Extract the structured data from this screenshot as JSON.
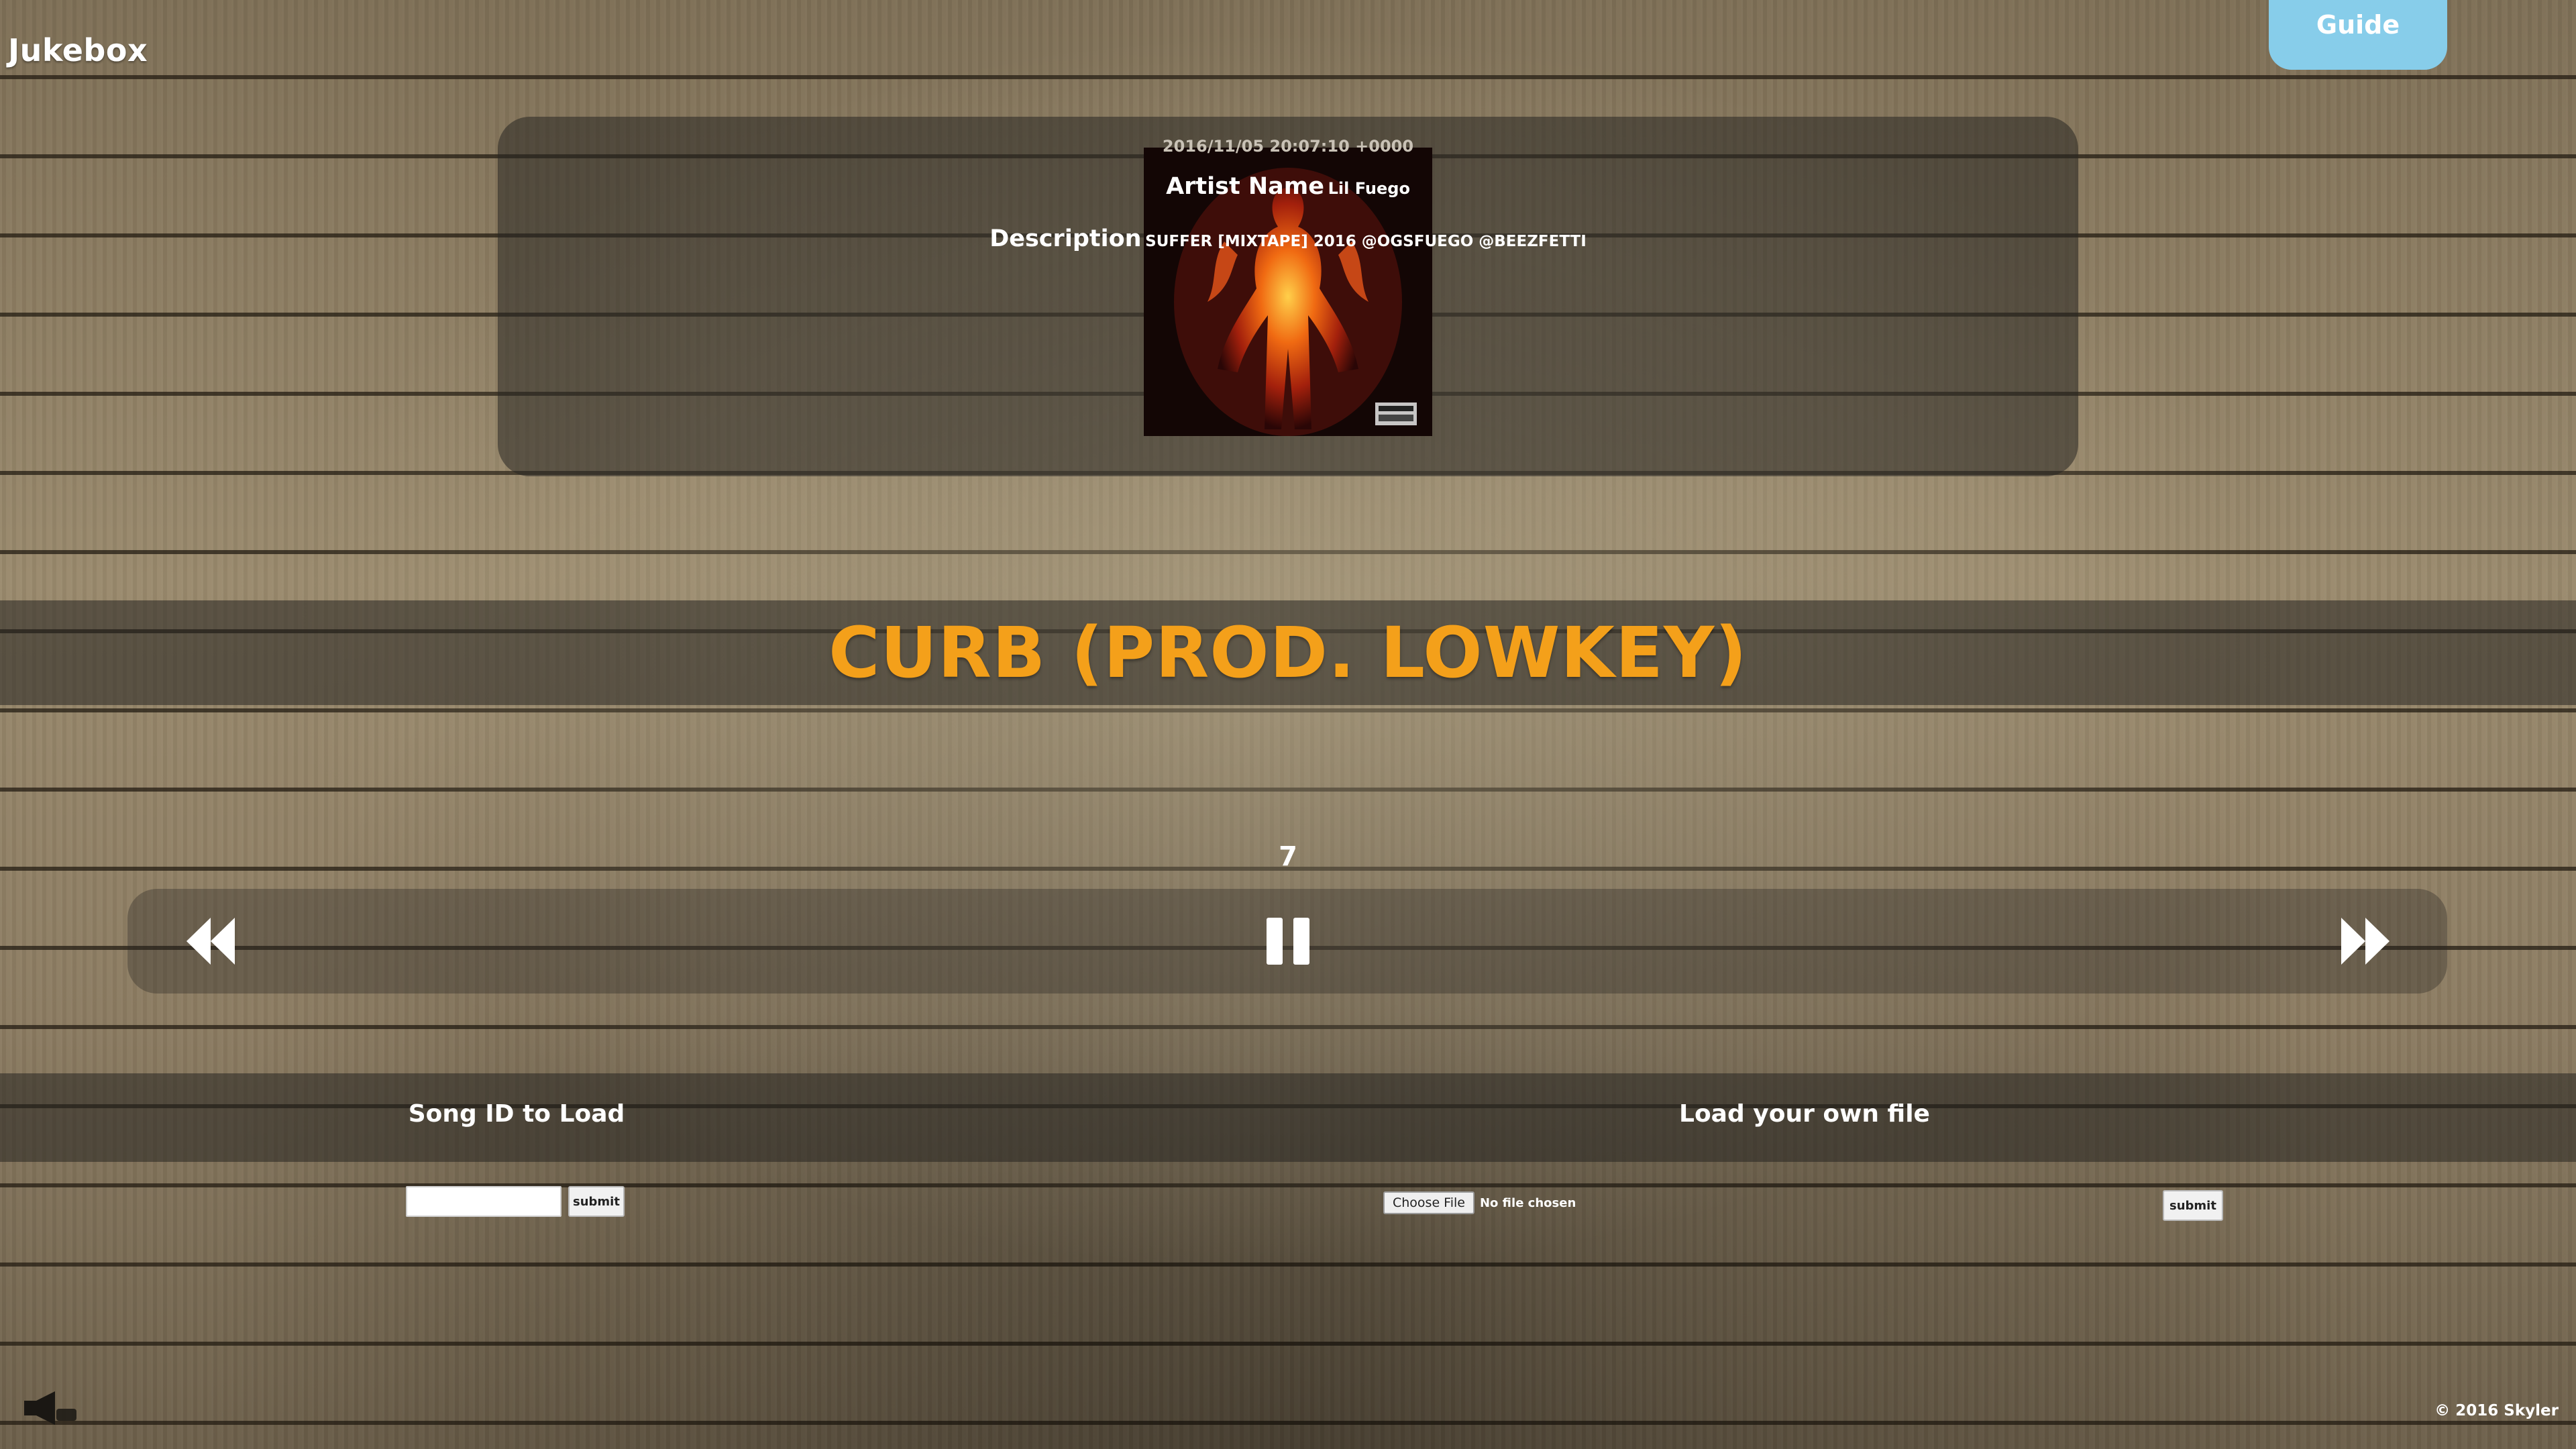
{
  "header": {
    "brand": "Jukebox",
    "guide_label": "Guide"
  },
  "track_info": {
    "timestamp": "2016/11/05 20:07:10 +0000",
    "artist_label": "Artist Name",
    "artist_value": "Lil Fuego",
    "description_label": "Description",
    "description_value": "SUFFER [MIXTAPE] 2016 @OGSFUEGO @BEEZFETTI",
    "album_art_icon": "flaming-figure-album-cover"
  },
  "now_playing": {
    "title": "CURB (PROD. LOWKEY)",
    "track_number": "7"
  },
  "controls": {
    "previous_icon": "rewind-icon",
    "pause_icon": "pause-icon",
    "next_icon": "fast-forward-icon"
  },
  "load_song_id": {
    "heading": "Song ID to Load",
    "input_value": "",
    "submit_label": "submit"
  },
  "load_file": {
    "heading": "Load your own file",
    "choose_label": "Choose File",
    "file_status": "No file chosen",
    "submit_label": "submit"
  },
  "footer": {
    "copyright": "© 2016 Skyler",
    "speaker_icon": "speaker-icon"
  },
  "colors": {
    "title_accent": "#f4a01a",
    "guide_button": "#87cdea"
  }
}
